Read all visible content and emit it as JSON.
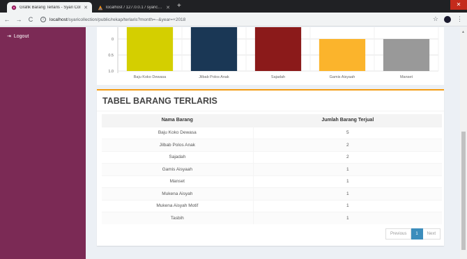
{
  "browser": {
    "tabs": [
      {
        "title": "Grafik Barang Terlaris - Syari Col",
        "active": true
      },
      {
        "title": "localhost / 127.0.0.1 / syaricolle",
        "active": false
      }
    ],
    "new_tab": "+",
    "close_window": "✕",
    "nav": {
      "back": "←",
      "forward": "→",
      "reload": "C"
    },
    "url": {
      "host": "localhost",
      "path": "/syaricollection/public/rekap/terlaris?month=--&year=+2018"
    },
    "star": "☆",
    "menu": "⋮"
  },
  "sidebar": {
    "logout_label": "Logout"
  },
  "chart_data": {
    "type": "bar",
    "categories": [
      "Baju Koko Dewasa",
      "Jilbab Polos Anak",
      "Sajadah",
      "Gamis Aisyaah",
      "Manset"
    ],
    "values": [
      5,
      2,
      2,
      1,
      1
    ],
    "colors": [
      "#d4cf00",
      "#1a3755",
      "#8b1a1a",
      "#fbb42c",
      "#999999"
    ],
    "y_ticks": [
      "1.0",
      "0.5",
      "0"
    ],
    "visible_ylim": [
      0,
      1.15
    ],
    "grid": true
  },
  "table_box": {
    "title": "TABEL BARANG TERLARIS",
    "columns": [
      "Nama Barang",
      "Jumlah Barang Terjual"
    ],
    "rows": [
      [
        "Baju Koko Dewasa",
        "5"
      ],
      [
        "Jilbab Polos Anak",
        "2"
      ],
      [
        "Sajadah",
        "2"
      ],
      [
        "Gamis Aisyaah",
        "1"
      ],
      [
        "Manset",
        "1"
      ],
      [
        "Mukena Aisyah",
        "1"
      ],
      [
        "Mukena Aisyah Motif",
        "1"
      ],
      [
        "Tasbih",
        "1"
      ]
    ],
    "pagination": {
      "previous": "Previous",
      "current": "1",
      "next": "Next"
    }
  }
}
